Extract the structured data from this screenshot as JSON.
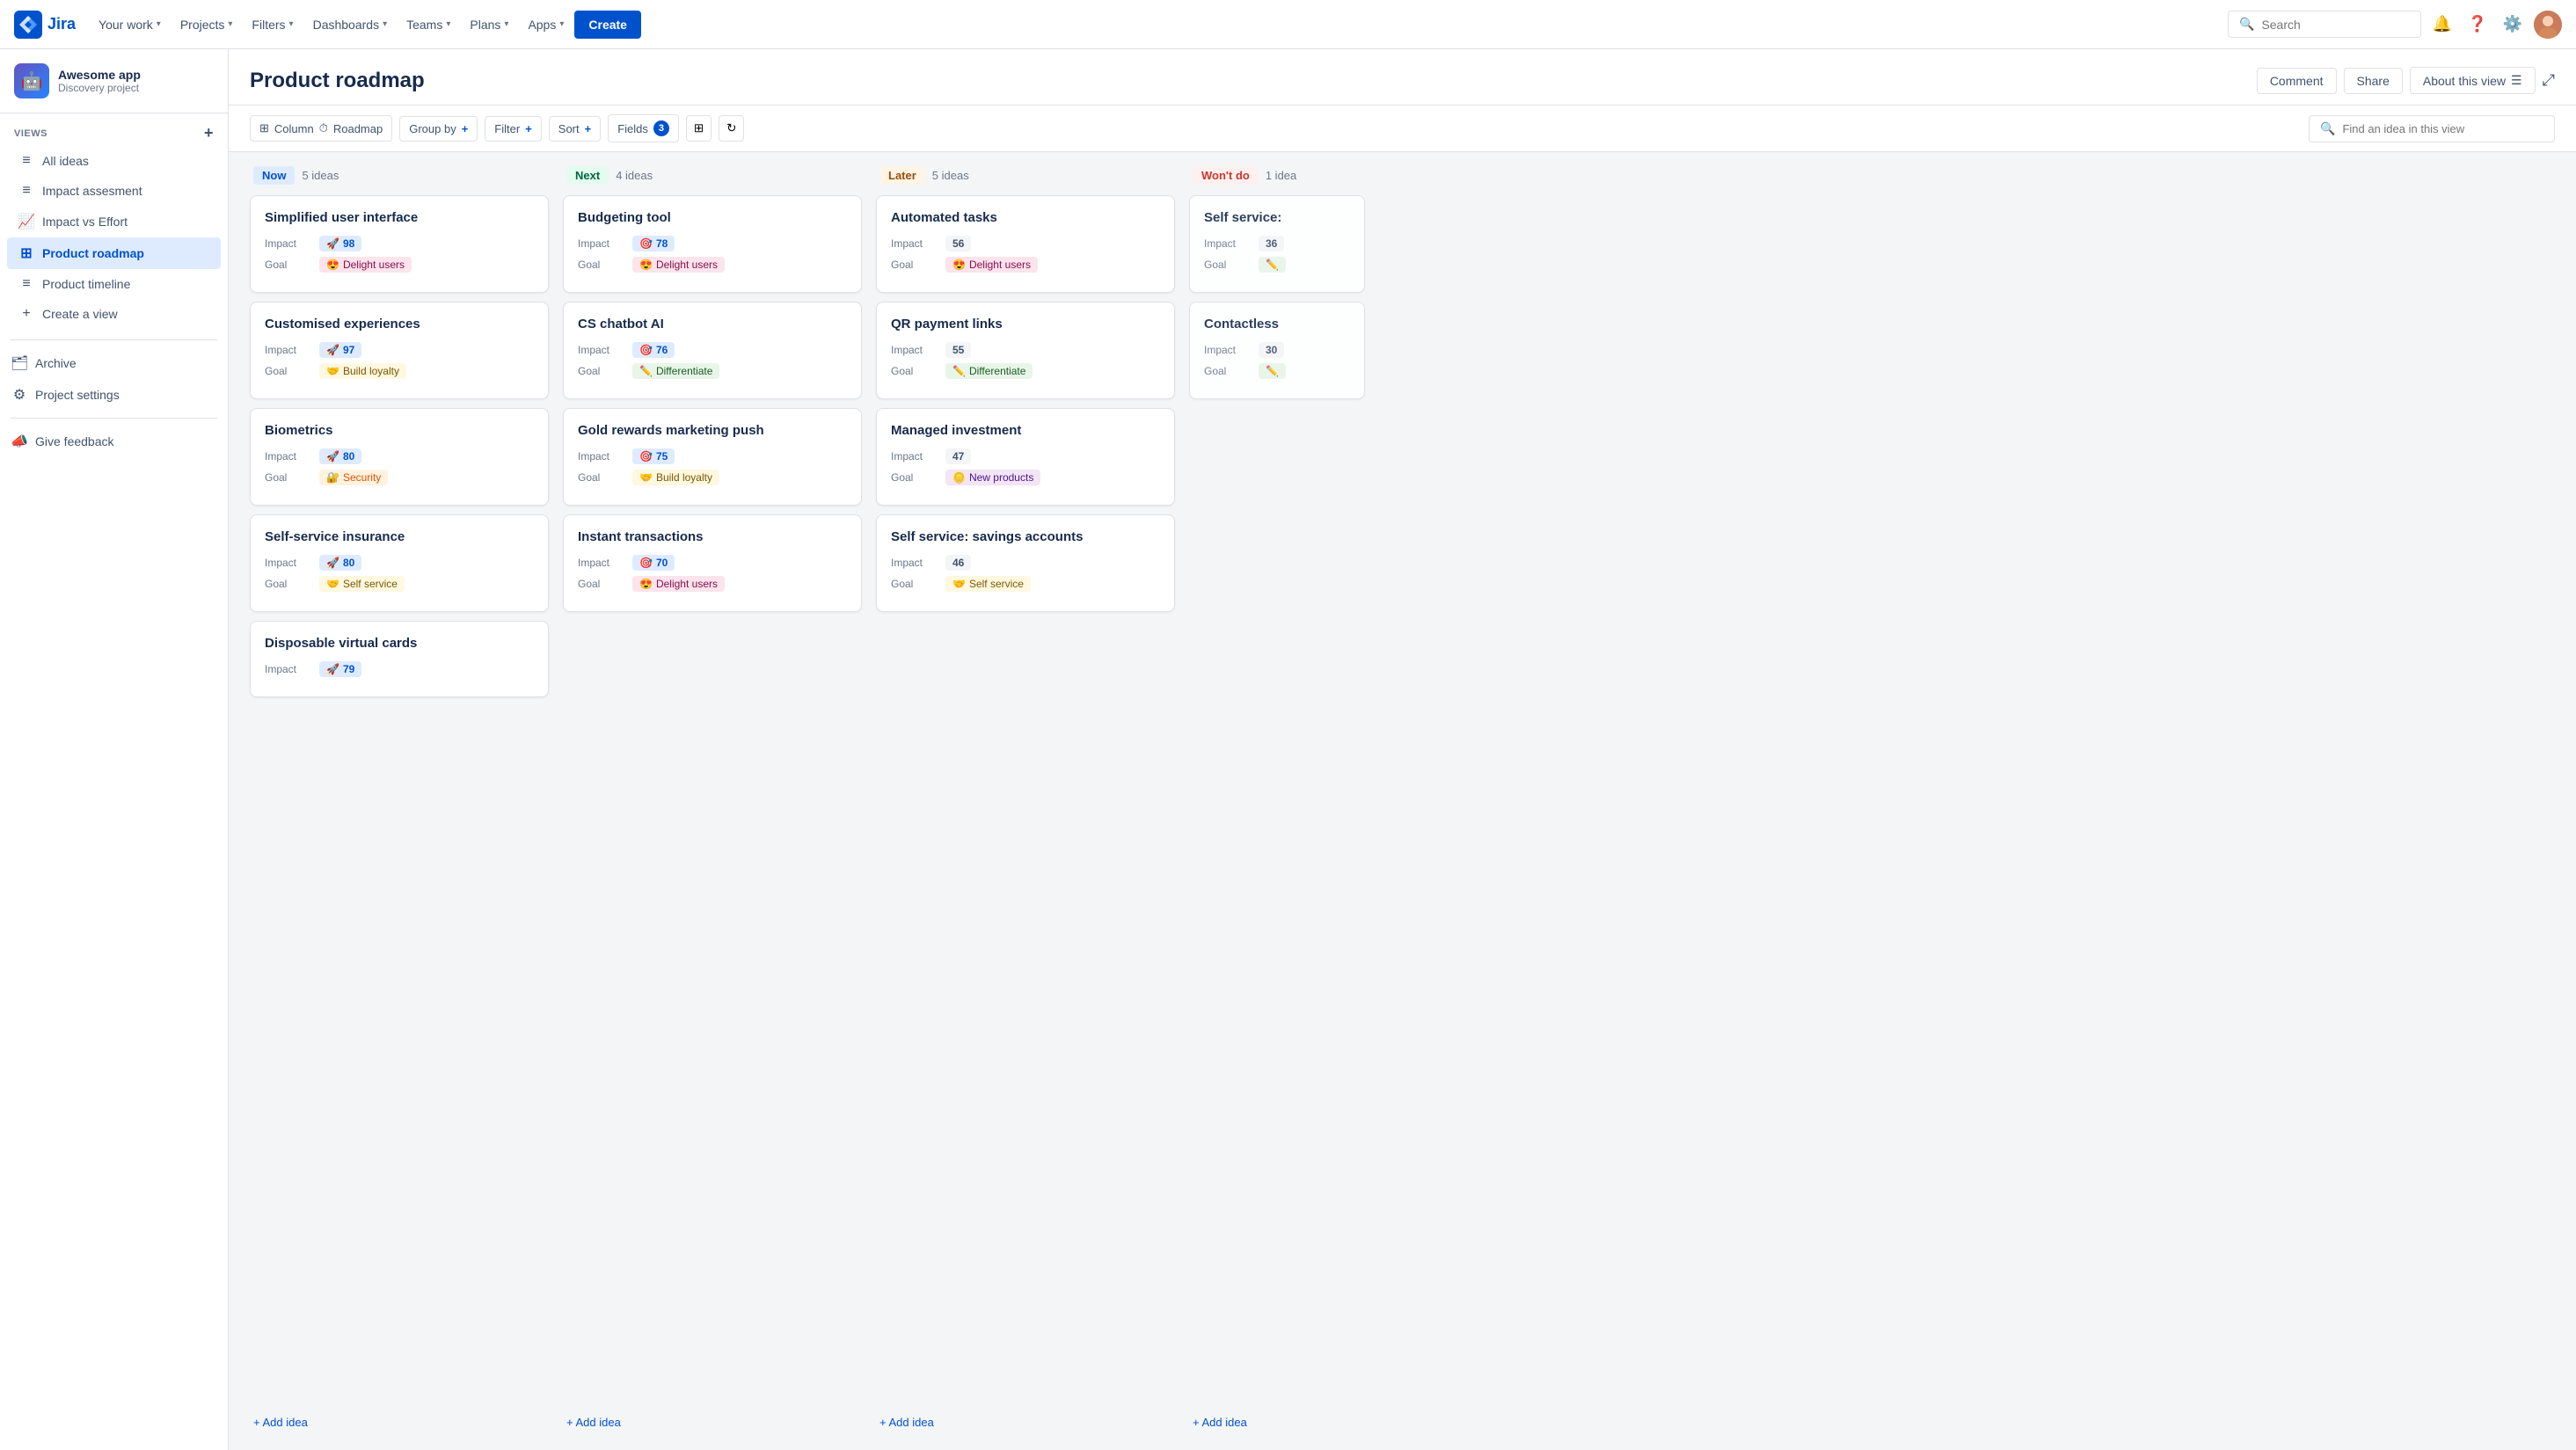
{
  "topnav": {
    "logo_text": "Jira",
    "nav_items": [
      {
        "label": "Your work",
        "has_chevron": true
      },
      {
        "label": "Projects",
        "has_chevron": true
      },
      {
        "label": "Filters",
        "has_chevron": true
      },
      {
        "label": "Dashboards",
        "has_chevron": true
      },
      {
        "label": "Teams",
        "has_chevron": true
      },
      {
        "label": "Plans",
        "has_chevron": true
      },
      {
        "label": "Apps",
        "has_chevron": true
      }
    ],
    "create_label": "Create",
    "search_placeholder": "Search"
  },
  "sidebar": {
    "project_name": "Awesome app",
    "project_type": "Discovery project",
    "views_label": "VIEWS",
    "add_view_label": "+",
    "items": [
      {
        "label": "All ideas",
        "icon": "≡"
      },
      {
        "label": "Impact assesment",
        "icon": "≡"
      },
      {
        "label": "Impact vs Effort",
        "icon": "📈"
      },
      {
        "label": "Product roadmap",
        "icon": "⊞",
        "active": true
      },
      {
        "label": "Product timeline",
        "icon": "≡"
      },
      {
        "label": "Create a view",
        "icon": "+"
      }
    ],
    "archive_label": "Archive",
    "project_settings_label": "Project settings",
    "feedback_label": "Give feedback"
  },
  "page": {
    "title": "Product roadmap",
    "header_buttons": {
      "comment": "Comment",
      "share": "Share",
      "about": "About this view"
    }
  },
  "toolbar": {
    "column_label": "Column",
    "roadmap_label": "Roadmap",
    "groupby_label": "Group by",
    "filter_label": "Filter",
    "sort_label": "Sort",
    "fields_label": "Fields",
    "fields_count": "3",
    "search_placeholder": "Find an idea in this view"
  },
  "columns": [
    {
      "id": "now",
      "label": "Now",
      "label_class": "label-now",
      "count": "5 ideas",
      "cards": [
        {
          "title": "Simplified user interface",
          "impact": "98",
          "impact_emoji": "🚀",
          "impact_color": "blue",
          "goal": "Delight users",
          "goal_emoji": "😍",
          "goal_class": "goal-delight"
        },
        {
          "title": "Customised experiences",
          "impact": "97",
          "impact_emoji": "🚀",
          "impact_color": "blue",
          "goal": "Build loyalty",
          "goal_emoji": "🤝",
          "goal_class": "goal-build"
        },
        {
          "title": "Biometrics",
          "impact": "80",
          "impact_emoji": "🚀",
          "impact_color": "blue",
          "goal": "Security",
          "goal_emoji": "🔐",
          "goal_class": "goal-security"
        },
        {
          "title": "Self-service insurance",
          "impact": "80",
          "impact_emoji": "🚀",
          "impact_color": "blue",
          "goal": "Self service",
          "goal_emoji": "🤝",
          "goal_class": "goal-selfservice"
        },
        {
          "title": "Disposable virtual cards",
          "impact": "79",
          "impact_emoji": "🚀",
          "impact_color": "blue",
          "goal": null,
          "goal_emoji": null,
          "goal_class": null
        }
      ],
      "add_label": "+ Add idea"
    },
    {
      "id": "next",
      "label": "Next",
      "label_class": "label-next",
      "count": "4 ideas",
      "cards": [
        {
          "title": "Budgeting tool",
          "impact": "78",
          "impact_emoji": "🎯",
          "impact_color": "blue",
          "goal": "Delight users",
          "goal_emoji": "😍",
          "goal_class": "goal-delight"
        },
        {
          "title": "CS chatbot AI",
          "impact": "76",
          "impact_emoji": "🎯",
          "impact_color": "blue",
          "goal": "Differentiate",
          "goal_emoji": "✏️",
          "goal_class": "goal-differentiate"
        },
        {
          "title": "Gold rewards marketing push",
          "impact": "75",
          "impact_emoji": "🎯",
          "impact_color": "blue",
          "goal": "Build loyalty",
          "goal_emoji": "🤝",
          "goal_class": "goal-build"
        },
        {
          "title": "Instant transactions",
          "impact": "70",
          "impact_emoji": "🎯",
          "impact_color": "blue",
          "goal": "Delight users",
          "goal_emoji": "😍",
          "goal_class": "goal-delight"
        }
      ],
      "add_label": "+ Add idea"
    },
    {
      "id": "later",
      "label": "Later",
      "label_class": "label-later",
      "count": "5 ideas",
      "cards": [
        {
          "title": "Automated tasks",
          "impact": "56",
          "impact_emoji": "",
          "impact_color": "gray",
          "goal": "Delight users",
          "goal_emoji": "😍",
          "goal_class": "goal-delight"
        },
        {
          "title": "QR payment links",
          "impact": "55",
          "impact_emoji": "",
          "impact_color": "gray",
          "goal": "Differentiate",
          "goal_emoji": "✏️",
          "goal_class": "goal-differentiate"
        },
        {
          "title": "Managed investment",
          "impact": "47",
          "impact_emoji": "",
          "impact_color": "gray",
          "goal": "New products",
          "goal_emoji": "🪙",
          "goal_class": "goal-newproducts"
        },
        {
          "title": "Self service: savings accounts",
          "impact": "46",
          "impact_emoji": "",
          "impact_color": "gray",
          "goal": "Self service",
          "goal_emoji": "🤝",
          "goal_class": "goal-selfservice"
        }
      ],
      "add_label": "+ Add idea"
    },
    {
      "id": "wontdo",
      "label": "Won't do",
      "label_class": "label-wontdo",
      "count": "1 idea",
      "cards": [
        {
          "title": "Self service:",
          "impact": "36",
          "impact_emoji": "",
          "impact_color": "gray",
          "goal": "",
          "goal_emoji": "✏️",
          "goal_class": "goal-differentiate",
          "partial": true
        },
        {
          "title": "Contactless",
          "impact": "30",
          "impact_emoji": "",
          "impact_color": "gray",
          "goal": "",
          "goal_emoji": "✏️",
          "goal_class": "goal-differentiate",
          "partial": true
        }
      ],
      "add_label": "+ Add idea"
    }
  ],
  "labels": {
    "impact": "Impact",
    "goal": "Goal"
  }
}
